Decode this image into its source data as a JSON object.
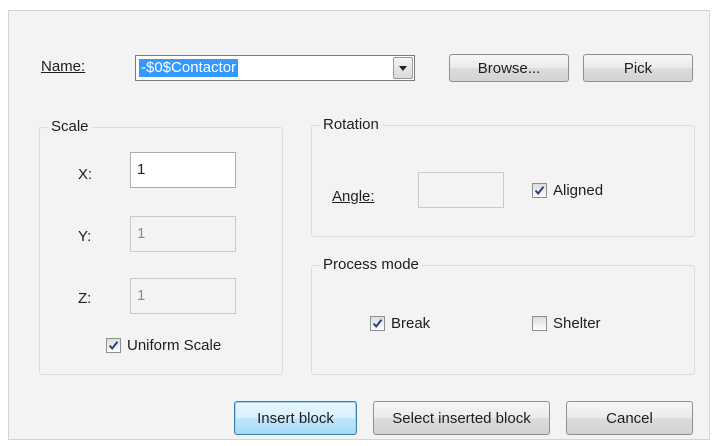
{
  "name": {
    "label": "Name:",
    "value": "-$0$Contactor",
    "browse_label": "Browse...",
    "pick_label": "Pick"
  },
  "scale": {
    "title": "Scale",
    "x_label": "X:",
    "x_value": "1",
    "y_label": "Y:",
    "y_value": "1",
    "z_label": "Z:",
    "z_value": "1",
    "uniform_label": "Uniform Scale",
    "uniform_checked": true
  },
  "rotation": {
    "title": "Rotation",
    "angle_label": "Angle:",
    "angle_value": "",
    "aligned_label": "Aligned",
    "aligned_checked": true
  },
  "process_mode": {
    "title": "Process mode",
    "break_label": "Break",
    "break_checked": true,
    "shelter_label": "Shelter",
    "shelter_checked": false
  },
  "footer": {
    "insert_label": "Insert block",
    "select_label": "Select inserted block",
    "cancel_label": "Cancel"
  },
  "colors": {
    "selection": "#3399ff",
    "dialog_background": "#f3f3f4",
    "default_button_border": "#3c7fb1"
  }
}
